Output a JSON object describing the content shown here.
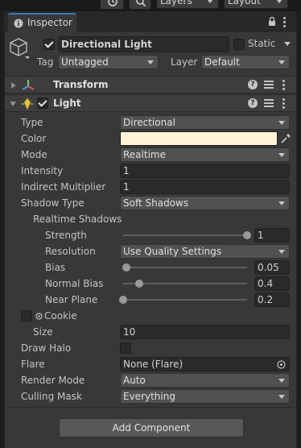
{
  "toolbar": {
    "layers_label": "Layers",
    "layout_label": "Layout"
  },
  "tab": {
    "label": "Inspector"
  },
  "object": {
    "name": "Directional Light",
    "active": true,
    "static_label": "Static",
    "tag_label": "Tag",
    "tag_value": "Untagged",
    "layer_label": "Layer",
    "layer_value": "Default"
  },
  "transform": {
    "title": "Transform"
  },
  "light": {
    "title": "Light",
    "enabled": true,
    "type_label": "Type",
    "type_value": "Directional",
    "color_label": "Color",
    "color_value": "#fff4d6",
    "mode_label": "Mode",
    "mode_value": "Realtime",
    "intensity_label": "Intensity",
    "intensity_value": "1",
    "indirect_label": "Indirect Multiplier",
    "indirect_value": "1",
    "shadow_type_label": "Shadow Type",
    "shadow_type_value": "Soft Shadows",
    "realtime_shadows_label": "Realtime Shadows",
    "strength_label": "Strength",
    "strength_value": "1",
    "strength_fraction": 1.0,
    "resolution_label": "Resolution",
    "resolution_value": "Use Quality Settings",
    "bias_label": "Bias",
    "bias_value": "0.05",
    "bias_fraction": 0.025,
    "normal_bias_label": "Normal Bias",
    "normal_bias_value": "0.4",
    "normal_bias_fraction": 0.133,
    "near_plane_label": "Near Plane",
    "near_plane_value": "0.2",
    "near_plane_fraction": 0.0,
    "cookie_label": "Cookie",
    "size_label": "Size",
    "size_value": "10",
    "draw_halo_label": "Draw Halo",
    "flare_label": "Flare",
    "flare_value": "None (Flare)",
    "render_mode_label": "Render Mode",
    "render_mode_value": "Auto",
    "culling_label": "Culling Mask",
    "culling_value": "Everything"
  },
  "add_component_label": "Add Component",
  "colors": {
    "accent": "#3a79bb",
    "panel_bg": "#383838",
    "field_bg": "#2a2a2a"
  }
}
